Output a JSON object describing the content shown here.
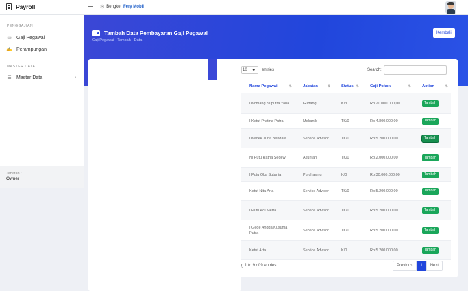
{
  "header": {
    "brand": "Payroll",
    "brand_icon": "calculator-icon",
    "company_prefix": "Bengkel",
    "company_name": "Fery Mobil"
  },
  "sidebar": {
    "section1": "PENGGAJIAN",
    "items1": [
      {
        "label": "Gaji Pegawai",
        "icon": "money-icon"
      },
      {
        "label": "Perampungan",
        "icon": "sign-icon"
      }
    ],
    "section2": "MASTER DATA",
    "items2": [
      {
        "label": "Master Data",
        "icon": "list-icon"
      }
    ],
    "role_label": "Jabatan :",
    "role_value": "Owner"
  },
  "banner": {
    "title": "Tambah Data Pembayaran Gaji Pegawai",
    "breadcrumb": "Gaji Pegawai - Tambah - Data",
    "back_button": "Kembali"
  },
  "table": {
    "length_value": "10",
    "length_label": "entries",
    "search_label": "Search:",
    "search_value": "",
    "columns": [
      "Nama Pegawai",
      "Jabatan",
      "Status",
      "Gaji Pokok",
      "Action"
    ],
    "rows": [
      {
        "nama": "I Komang Suputra Yana",
        "jabatan": "Gudang",
        "status": "K/3",
        "gaji": "Rp.20.000.000,00",
        "action": "Tambah"
      },
      {
        "nama": "I Ketut Pratina Putra",
        "jabatan": "Mekanik",
        "status": "TK/0",
        "gaji": "Rp.4.800.000,00",
        "action": "Tambah"
      },
      {
        "nama": "I Kadek Juna Bendala",
        "jabatan": "Service Advisor",
        "status": "TK/0",
        "gaji": "Rp.5.200.000,00",
        "action": "Tambah"
      },
      {
        "nama": "Ni Putu Ratna Sedewi",
        "jabatan": "Akuntan",
        "status": "TK/0",
        "gaji": "Rp.2.000.000,00",
        "action": "Tambah"
      },
      {
        "nama": "I Putu Oka Sutania",
        "jabatan": "Purchasing",
        "status": "K/0",
        "gaji": "Rp.30.000.000,00",
        "action": "Tambah"
      },
      {
        "nama": "Ketut Nita Arta",
        "jabatan": "Service Advisor",
        "status": "TK/0",
        "gaji": "Rp.5.200.000,00",
        "action": "Tambah"
      },
      {
        "nama": "I Putu Adi Merta",
        "jabatan": "Service Advisor",
        "status": "TK/0",
        "gaji": "Rp.5.200.000,00",
        "action": "Tambah"
      },
      {
        "nama": "I Gede Angga Kusuma Putra",
        "jabatan": "Service Advisor",
        "status": "TK/0",
        "gaji": "Rp.5.200.000,00",
        "action": "Tambah"
      },
      {
        "nama": "Ketut Arta",
        "jabatan": "Service Advisor",
        "status": "K/0",
        "gaji": "Rp.5.200.000,00",
        "action": "Tambah"
      }
    ],
    "info": "g 1 to 9 of 9 entries",
    "pagination": {
      "prev": "Previous",
      "current": "1",
      "next": "Next"
    }
  },
  "colors": {
    "accent": "#2146dc",
    "success": "#1aa65a"
  }
}
